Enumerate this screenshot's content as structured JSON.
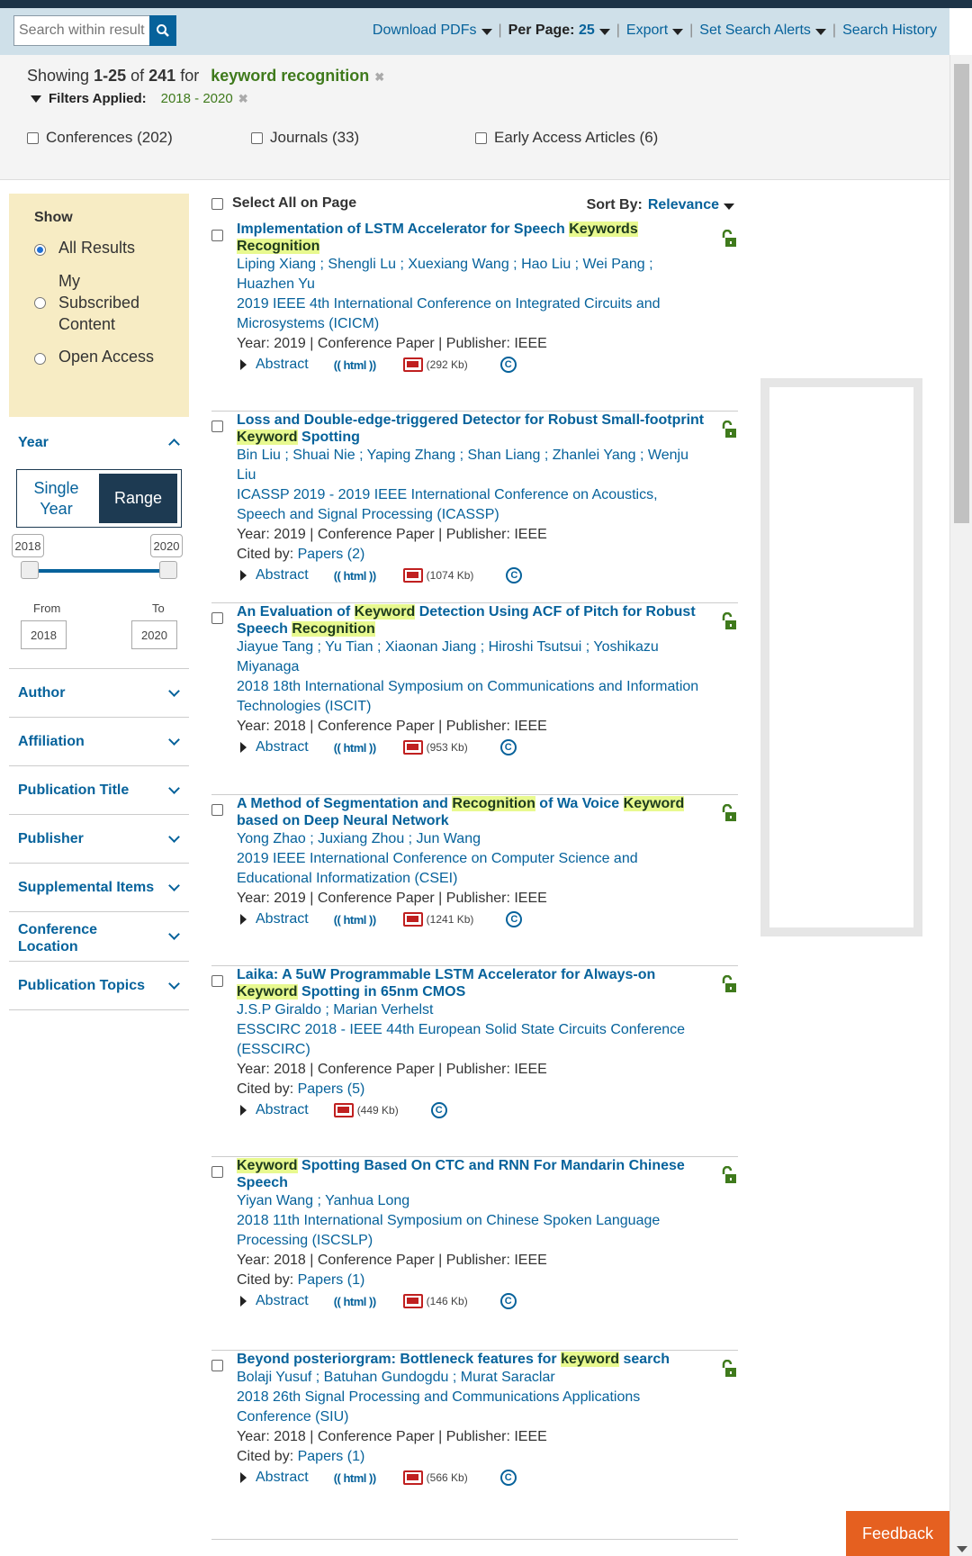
{
  "toolbar": {
    "search_placeholder": "Search within results",
    "download_pdfs": "Download PDFs",
    "per_page_label": "Per Page:",
    "per_page_value": "25",
    "export": "Export",
    "set_search_alerts": "Set Search Alerts",
    "search_history": "Search History"
  },
  "summary": {
    "showing": "Showing",
    "range": "1-25",
    "of": "of",
    "total": "241",
    "for": "for",
    "query": "keyword recognition",
    "filters_label": "Filters Applied:",
    "filter_value": "2018 - 2020"
  },
  "content_types": [
    {
      "label": "Conferences (202)"
    },
    {
      "label": "Journals (33)"
    },
    {
      "label": "Early Access Articles (6)"
    }
  ],
  "sidebar": {
    "show_header": "Show",
    "show_options": [
      {
        "label": "All Results",
        "selected": true
      },
      {
        "label": "My Subscribed Content",
        "selected": false
      },
      {
        "label": "Open Access",
        "selected": false
      }
    ],
    "year": {
      "label": "Year",
      "single_year": "Single Year",
      "range": "Range",
      "min": "2018",
      "max": "2020",
      "from_label": "From",
      "to_label": "To",
      "from": "2018",
      "to": "2020"
    },
    "facets": [
      {
        "label": "Author"
      },
      {
        "label": "Affiliation"
      },
      {
        "label": "Publication Title"
      },
      {
        "label": "Publisher"
      },
      {
        "label": "Supplemental Items"
      },
      {
        "label": "Conference Location"
      },
      {
        "label": "Publication Topics"
      }
    ]
  },
  "results_header": {
    "select_all": "Select All on Page",
    "sort_by": "Sort By:",
    "sort_value": "Relevance"
  },
  "results": [
    {
      "title": [
        "Implementation of LSTM Accelerator for Speech ",
        "Keywords",
        " ",
        "Recognition",
        ""
      ],
      "authors": "Liping Xiang ; Shengli Lu ; Xuexiang Wang ; Hao Liu ; Wei Pang ; Huazhen Yu",
      "publication": "2019 IEEE 4th International Conference on Integrated Circuits and Microsystems (ICICM)",
      "meta": "Year: 2019 | Conference Paper | Publisher: IEEE",
      "cited": "",
      "abstract": "Abstract",
      "html": "(( html ))",
      "pdf_size": "(292 Kb)"
    },
    {
      "title": [
        "Loss and Double-edge-triggered Detector for Robust Small-footprint ",
        "Keyword",
        " Spotting",
        "",
        ""
      ],
      "authors": "Bin Liu ; Shuai Nie ; Yaping Zhang ; Shan Liang ; Zhanlei Yang ; Wenju Liu",
      "publication": "ICASSP 2019 - 2019 IEEE International Conference on Acoustics, Speech and Signal Processing (ICASSP)",
      "meta": "Year: 2019 | Conference Paper | Publisher: IEEE",
      "cited": "Papers (2)",
      "abstract": "Abstract",
      "html": "(( html ))",
      "pdf_size": "(1074 Kb)"
    },
    {
      "title": [
        "An Evaluation of ",
        "Keyword",
        " Detection Using ACF of Pitch for Robust Speech ",
        "Recognition",
        ""
      ],
      "authors": "Jiayue Tang ; Yu Tian ; Xiaonan Jiang ; Hiroshi Tsutsui ; Yoshikazu Miyanaga",
      "publication": "2018 18th International Symposium on Communications and Information Technologies (ISCIT)",
      "meta": "Year: 2018 | Conference Paper | Publisher: IEEE",
      "cited": "",
      "abstract": "Abstract",
      "html": "(( html ))",
      "pdf_size": "(953 Kb)"
    },
    {
      "title": [
        "A Method of Segmentation and ",
        "Recognition",
        " of Wa Voice ",
        "Keyword",
        " based on Deep Neural Network"
      ],
      "authors": "Yong Zhao ; Juxiang Zhou ; Jun Wang",
      "publication": "2019 IEEE International Conference on Computer Science and Educational Informatization (CSEI)",
      "meta": "Year: 2019 | Conference Paper | Publisher: IEEE",
      "cited": "",
      "abstract": "Abstract",
      "html": "(( html ))",
      "pdf_size": "(1241 Kb)"
    },
    {
      "title": [
        "Laika: A 5uW Programmable LSTM Accelerator for Always-on ",
        "Keyword",
        " Spotting in 65nm CMOS",
        "",
        ""
      ],
      "authors": "J.S.P Giraldo ; Marian Verhelst",
      "publication": "ESSCIRC 2018 - IEEE 44th European Solid State Circuits Conference (ESSCIRC)",
      "meta": "Year: 2018 | Conference Paper | Publisher: IEEE",
      "cited": "Papers (5)",
      "abstract": "Abstract",
      "html": "",
      "pdf_size": "(449 Kb)"
    },
    {
      "title": [
        "",
        "Keyword",
        " Spotting Based On CTC and RNN For Mandarin Chinese Speech",
        "",
        ""
      ],
      "authors": "Yiyan Wang ; Yanhua Long",
      "publication": "2018 11th International Symposium on Chinese Spoken Language Processing (ISCSLP)",
      "meta": "Year: 2018 | Conference Paper | Publisher: IEEE",
      "cited": "Papers (1)",
      "abstract": "Abstract",
      "html": "(( html ))",
      "pdf_size": "(146 Kb)"
    },
    {
      "title": [
        "Beyond posteriorgram: Bottleneck features for ",
        "keyword",
        " search",
        "",
        ""
      ],
      "authors": "Bolaji Yusuf ; Batuhan Gundogdu ; Murat Saraclar",
      "publication": "2018 26th Signal Processing and Communications Applications Conference (SIU)",
      "meta": "Year: 2018 | Conference Paper | Publisher: IEEE",
      "cited": "Papers (1)",
      "abstract": "Abstract",
      "html": "(( html ))",
      "pdf_size": "(566 Kb)"
    }
  ],
  "cited_label": "Cited by:",
  "feedback": "Feedback",
  "colors": {
    "link": "#06629b",
    "highlight": "#e8f98f",
    "accent": "#e56020",
    "navy": "#1d3a52"
  }
}
